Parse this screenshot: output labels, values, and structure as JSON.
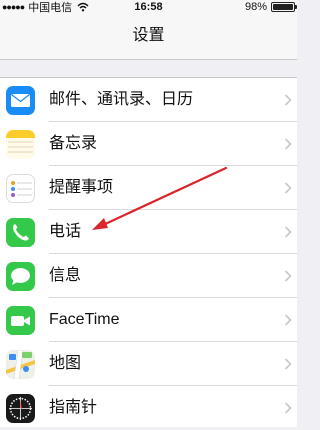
{
  "status_bar": {
    "signal_icon": "signal-dots",
    "carrier": "中国电信",
    "wifi_icon": "wifi",
    "time": "16:58",
    "battery_text": "98%",
    "battery_level": 0.98
  },
  "nav": {
    "title": "设置"
  },
  "settings": {
    "items": [
      {
        "label": "邮件、通讯录、日历",
        "icon": "mail-icon",
        "color": "#1a8cf5"
      },
      {
        "label": "备忘录",
        "icon": "notes-icon",
        "color": "#fbcc2a"
      },
      {
        "label": "提醒事项",
        "icon": "reminders-icon",
        "color": "#ffffff"
      },
      {
        "label": "电话",
        "icon": "phone-icon",
        "color": "#34c94a"
      },
      {
        "label": "信息",
        "icon": "messages-icon",
        "color": "#34c94a"
      },
      {
        "label": "FaceTime",
        "icon": "facetime-icon",
        "color": "#34c94a"
      },
      {
        "label": "地图",
        "icon": "maps-icon",
        "color": "#f0f0ea"
      },
      {
        "label": "指南针",
        "icon": "compass-icon",
        "color": "#1a1a1a"
      }
    ]
  },
  "annotation": {
    "color": "#d9252b",
    "points_to": "电话"
  }
}
